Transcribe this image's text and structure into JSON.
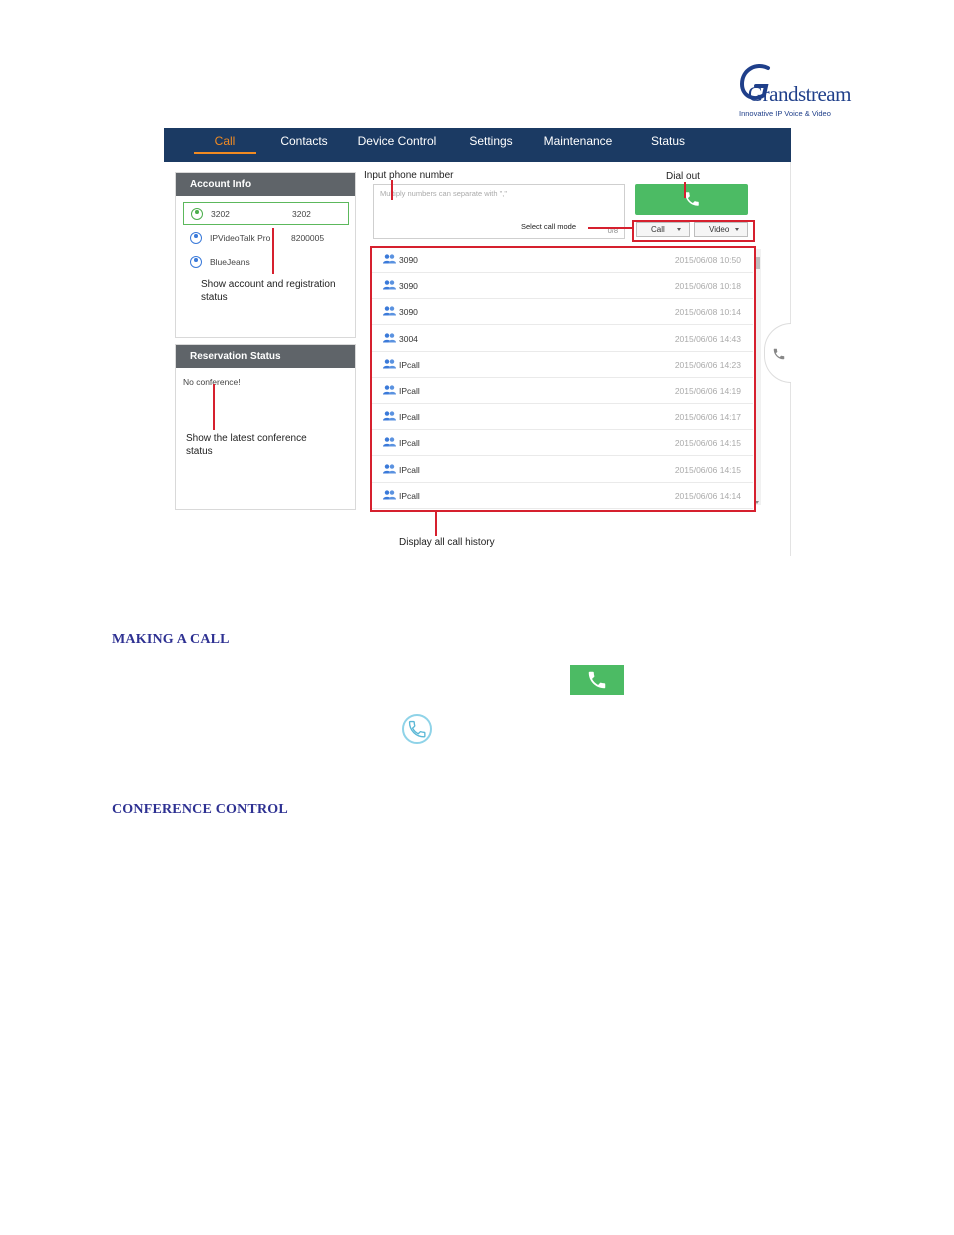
{
  "logo": {
    "word": "Grandstream",
    "tagline": "Innovative IP Voice & Video"
  },
  "nav": {
    "items": [
      "Call",
      "Contacts",
      "Device Control",
      "Settings",
      "Maintenance",
      "Status"
    ]
  },
  "account_panel": {
    "title": "Account Info",
    "accounts": [
      {
        "name": "3202",
        "number": "3202"
      },
      {
        "name": "IPVideoTalk Pro",
        "number": "8200005"
      },
      {
        "name": "BlueJeans",
        "number": ""
      }
    ]
  },
  "reservation_panel": {
    "title": "Reservation Status",
    "message": "No conference!"
  },
  "input": {
    "placeholder": "Multiply numbers can separate with \",\"",
    "count": "0/8"
  },
  "modes": {
    "call": "Call",
    "video": "Video"
  },
  "history": [
    {
      "name": "3090",
      "time": "2015/06/08 10:50"
    },
    {
      "name": "3090",
      "time": "2015/06/08 10:18"
    },
    {
      "name": "3090",
      "time": "2015/06/08 10:14"
    },
    {
      "name": "3004",
      "time": "2015/06/06 14:43"
    },
    {
      "name": "IPcall",
      "time": "2015/06/06 14:23"
    },
    {
      "name": "IPcall",
      "time": "2015/06/06 14:19"
    },
    {
      "name": "IPcall",
      "time": "2015/06/06 14:17"
    },
    {
      "name": "IPcall",
      "time": "2015/06/06 14:15"
    },
    {
      "name": "IPcall",
      "time": "2015/06/06 14:15"
    },
    {
      "name": "IPcall",
      "time": "2015/06/06 14:14"
    }
  ],
  "annotations": {
    "input_phone": "Input phone number",
    "dial_out": "Dial out",
    "select_mode": "Select call mode",
    "account_status": "Show account and registration status",
    "conference_status": "Show the latest conference status",
    "call_history": "Display all call history"
  },
  "document": {
    "heading_making_call": "MAKING A CALL",
    "heading_conference": "CONFERENCE CONTROL"
  },
  "colors": {
    "navbar": "#1b3a63",
    "active_tab": "#f08a22",
    "dial_green": "#4cbb64",
    "annotation_red": "#d6202e",
    "heading_blue": "#2e3192"
  }
}
